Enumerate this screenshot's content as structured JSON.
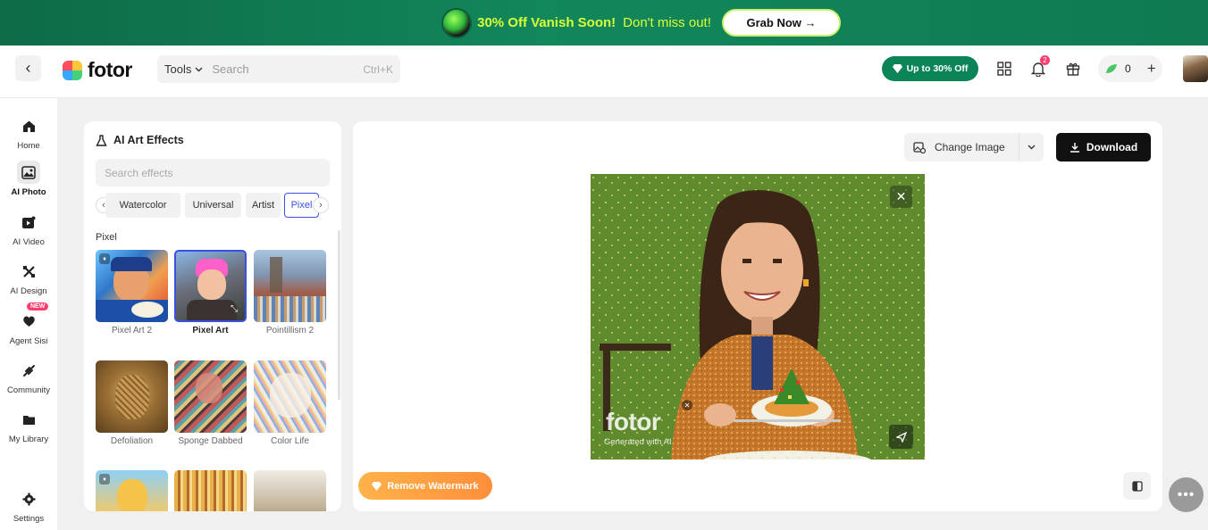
{
  "promo_banner": {
    "highlight": "30% Off Vanish Soon!",
    "text": "Don't miss out!",
    "button_label": "Grab Now →"
  },
  "topbar": {
    "logo_text": "fotor",
    "tools_label": "Tools",
    "search_placeholder": "Search",
    "search_shortcut": "Ctrl+K",
    "promo_pill": "Up to 30% Off",
    "notification_count": "2",
    "credits": "0"
  },
  "leftnav": {
    "items": [
      {
        "label": "Home",
        "icon": "home-icon"
      },
      {
        "label": "AI Photo",
        "icon": "ai-photo-icon"
      },
      {
        "label": "AI Video",
        "icon": "ai-video-icon"
      },
      {
        "label": "AI Design",
        "icon": "ai-design-icon"
      },
      {
        "label": "Agent Sisi",
        "icon": "agent-sisi-icon",
        "badge": "NEW"
      },
      {
        "label": "Community",
        "icon": "community-icon"
      },
      {
        "label": "My Library",
        "icon": "folder-icon"
      }
    ],
    "settings_label": "Settings",
    "active_item": "AI Photo"
  },
  "effects_panel": {
    "title": "AI Art Effects",
    "search_placeholder": "Search effects",
    "chips": [
      "Watercolor",
      "Universal",
      "Artist",
      "Pixel"
    ],
    "active_chip": "Pixel",
    "section_label": "Pixel",
    "thumbnails": [
      {
        "label": "Pixel Art 2"
      },
      {
        "label": "Pixel Art"
      },
      {
        "label": "Pointillism 2"
      },
      {
        "label": "Defoliation"
      },
      {
        "label": "Sponge Dabbed"
      },
      {
        "label": "Color Life"
      }
    ],
    "selected_thumbnail": "Pixel Art"
  },
  "canvas": {
    "change_image_label": "Change Image",
    "download_label": "Download",
    "watermark_logo": "fotor",
    "watermark_sub": "Generated with AI",
    "remove_watermark_label": "Remove Watermark"
  },
  "colors": {
    "accent": "#3a50e0",
    "promo_green": "#0b8457",
    "download_bg": "#111111",
    "remove_wm_orange": "#ff9a3c"
  }
}
